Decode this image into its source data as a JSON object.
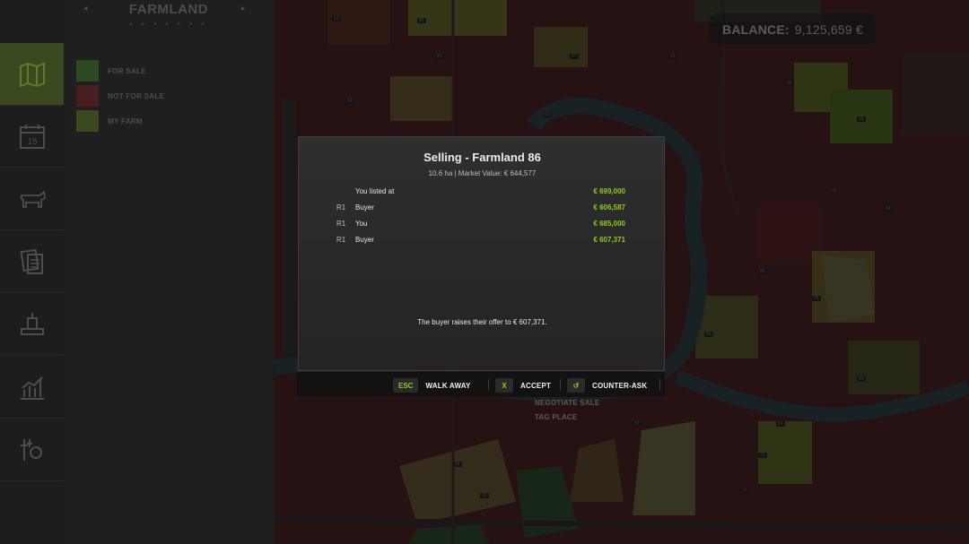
{
  "panel": {
    "title": "FARMLAND",
    "nav_prev": "◂",
    "nav_next": "▸",
    "dots": "● ● ● ● ● ● ●",
    "legend": [
      {
        "label": "FOR SALE",
        "color": "#2c4a20"
      },
      {
        "label": "NOT FOR SALE",
        "color": "#4a1e1e"
      },
      {
        "label": "MY FARM",
        "color": "#3b4a1e"
      }
    ]
  },
  "rail": {
    "items": [
      {
        "icon": "map-icon",
        "active": true
      },
      {
        "icon": "calendar-icon",
        "active": false
      },
      {
        "icon": "cow-icon",
        "active": false
      },
      {
        "icon": "contracts-icon",
        "active": false
      },
      {
        "icon": "production-icon",
        "active": false
      },
      {
        "icon": "stats-icon",
        "active": false
      },
      {
        "icon": "settings-icon",
        "active": false
      }
    ],
    "calendar_day": "15"
  },
  "balance": {
    "label": "BALANCE:",
    "value": "9,125,659 €"
  },
  "dialog": {
    "title": "Selling - Farmland 86",
    "subtitle": "10.6 ha  |  Market Value: € 644,577",
    "offers": [
      {
        "round": "",
        "party": "You listed at",
        "amount": "€ 699,000"
      },
      {
        "round": "R1",
        "party": "Buyer",
        "amount": "€ 606,587"
      },
      {
        "round": "R1",
        "party": "You",
        "amount": "€ 685,000"
      },
      {
        "round": "R1",
        "party": "Buyer",
        "amount": "€ 607,371"
      }
    ],
    "message": "The buyer raises their offer to € 607,371."
  },
  "actions": {
    "walk_away": {
      "key": "ESC",
      "label": "WALK AWAY"
    },
    "accept": {
      "key": "X",
      "label": "ACCEPT"
    },
    "counter": {
      "key": "↺",
      "label": "COUNTER-ASK"
    }
  },
  "context_menu": {
    "negotiate": "NEGOTIATE SALE",
    "tag": "TAG PLACE"
  },
  "map_labels": [
    "53",
    "86",
    "57",
    "64",
    "61",
    "62",
    "60",
    "55",
    "58",
    "65",
    "69",
    "66",
    "76",
    "83",
    "90",
    "94",
    "95",
    "82",
    "87",
    "73",
    "51",
    "72"
  ],
  "colors": {
    "accent": "#8ecb1f",
    "panel_bg": "#1f1f1f",
    "map_red": "#4a1d1f"
  }
}
